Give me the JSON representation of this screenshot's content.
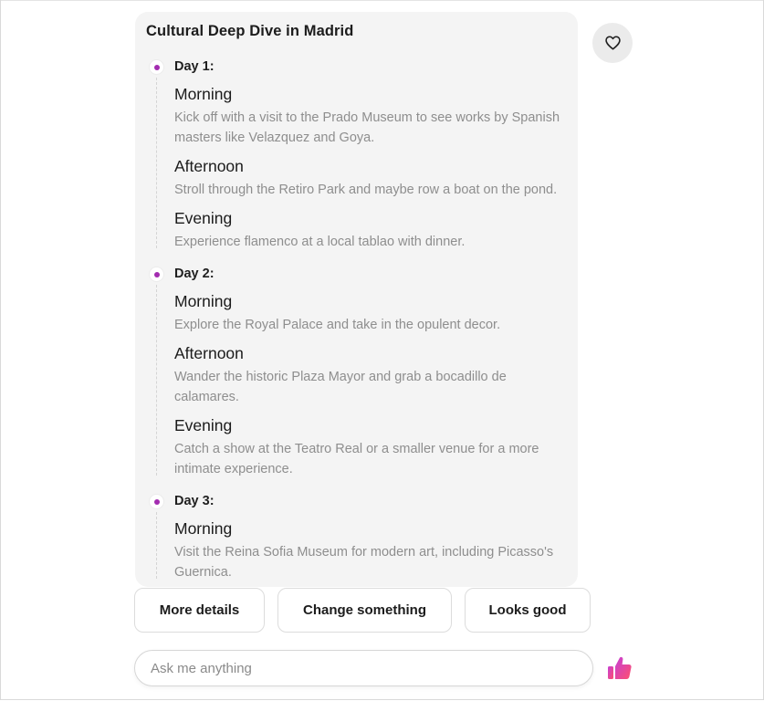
{
  "card": {
    "title": "Cultural Deep Dive in Madrid",
    "days": [
      {
        "label": "Day 1:",
        "slots": [
          {
            "title": "Morning",
            "desc": "Kick off with a visit to the Prado Museum to see works by Spanish masters like Velazquez and Goya."
          },
          {
            "title": "Afternoon",
            "desc": "Stroll through the Retiro Park and maybe row a boat on the pond."
          },
          {
            "title": "Evening",
            "desc": "Experience flamenco at a local tablao with dinner."
          }
        ]
      },
      {
        "label": "Day 2:",
        "slots": [
          {
            "title": "Morning",
            "desc": "Explore the Royal Palace and take in the opulent decor."
          },
          {
            "title": "Afternoon",
            "desc": "Wander the historic Plaza Mayor and grab a bocadillo de calamares."
          },
          {
            "title": "Evening",
            "desc": "Catch a show at the Teatro Real or a smaller venue for a more intimate experience."
          }
        ]
      },
      {
        "label": "Day 3:",
        "slots": [
          {
            "title": "Morning",
            "desc": "Visit the Reina Sofia Museum for modern art, including Picasso's Guernica."
          }
        ]
      }
    ]
  },
  "actions": {
    "more_details": "More details",
    "change_something": "Change something",
    "looks_good": "Looks good"
  },
  "input": {
    "placeholder": "Ask me anything",
    "value": ""
  },
  "icons": {
    "heart": "heart-icon",
    "thumb": "thumbs-up-icon"
  },
  "colors": {
    "accent": "#a32cb0",
    "thumb_gradient_start": "#c63fd6",
    "thumb_gradient_end": "#ff4f6e",
    "card_bg": "#f4f4f4"
  }
}
